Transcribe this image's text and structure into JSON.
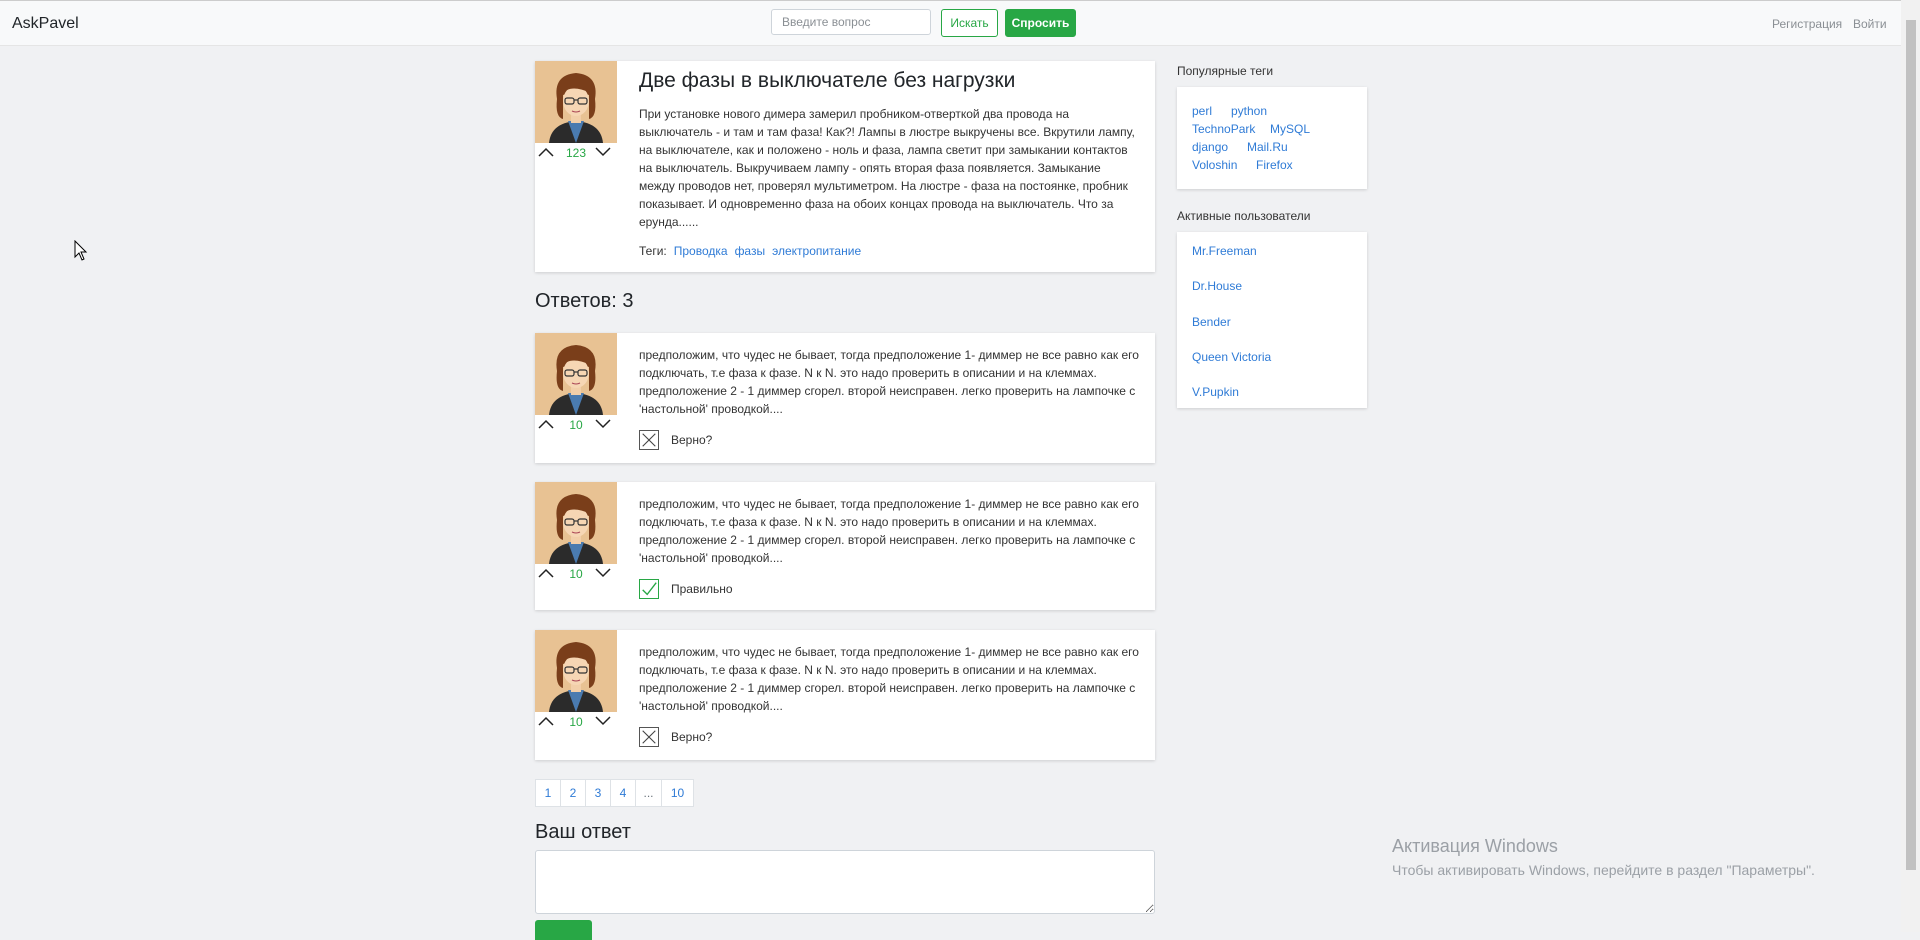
{
  "navbar": {
    "brand": "AskPavel",
    "search_placeholder": "Введите вопрос",
    "search_button": "Искать",
    "ask_button": "Спросить",
    "register_link": "Регистрация",
    "login_link": "Войти"
  },
  "question": {
    "title": "Две фазы в выключателе без нагрузки",
    "body": "При установке нового димера замерил пробником-отверткой два провода на выключатель - и там и там фаза! Как?! Лампы в люстре выкручены все. Вкрутили лампу, на выключателе, как и положено - ноль и фаза, лампа светит при замыкании контактов на выключатель. Выкручиваем лампу - опять вторая фаза появляется. Замыкание между проводов нет, проверял мультиметром. На люстре - фаза на постоянке, пробник показывает. И одновременно фаза на обоих концах провода на выключатель. Что за ерунда......",
    "votes": "123",
    "tags_label": "Теги:",
    "tags": [
      "Проводка",
      "фазы",
      "электропитание"
    ]
  },
  "answers_heading": "Ответов: 3",
  "answers": [
    {
      "body": "предположим, что чудес не бывает, тогда предположение 1- диммер не все равно как его подключать, т.е фаза к фазе. N к N. это надо проверить в описании и на клеммах. предположение 2 - 1 диммер сгорел. второй неисправен. легко проверить на лампочке с 'настольной' проводкой....",
      "votes": "10",
      "check_label": "Верно?",
      "correct": false
    },
    {
      "body": "предположим, что чудес не бывает, тогда предположение 1- диммер не все равно как его подключать, т.е фаза к фазе. N к N. это надо проверить в описании и на клеммах. предположение 2 - 1 диммер сгорел. второй неисправен. легко проверить на лампочке с 'настольной' проводкой....",
      "votes": "10",
      "check_label": "Правильно",
      "correct": true
    },
    {
      "body": "предположим, что чудес не бывает, тогда предположение 1- диммер не все равно как его подключать, т.е фаза к фазе. N к N. это надо проверить в описании и на клеммах. предположение 2 - 1 диммер сгорел. второй неисправен. легко проверить на лампочке с 'настольной' проводкой....",
      "votes": "10",
      "check_label": "Верно?",
      "correct": false
    }
  ],
  "pagination": [
    "1",
    "2",
    "3",
    "4",
    "...",
    "10"
  ],
  "your_answer_heading": "Ваш ответ",
  "sidebar": {
    "popular_tags_heading": "Популярные теги",
    "popular_tags": [
      "perl",
      "python",
      "TechnoPark",
      "MySQL",
      "django",
      "Mail.Ru",
      "Voloshin",
      "Firefox"
    ],
    "active_users_heading": "Активные пользователи",
    "active_users": [
      "Mr.Freeman",
      "Dr.House",
      "Bender",
      "Queen Victoria",
      "V.Pupkin"
    ]
  },
  "watermark": {
    "title": "Активация Windows",
    "subtitle": "Чтобы активировать Windows, перейдите в раздел \"Параметры\"."
  },
  "colors": {
    "accent_green": "#28a745",
    "link_blue": "#2f7bd6",
    "background": "#f0f1f3"
  }
}
